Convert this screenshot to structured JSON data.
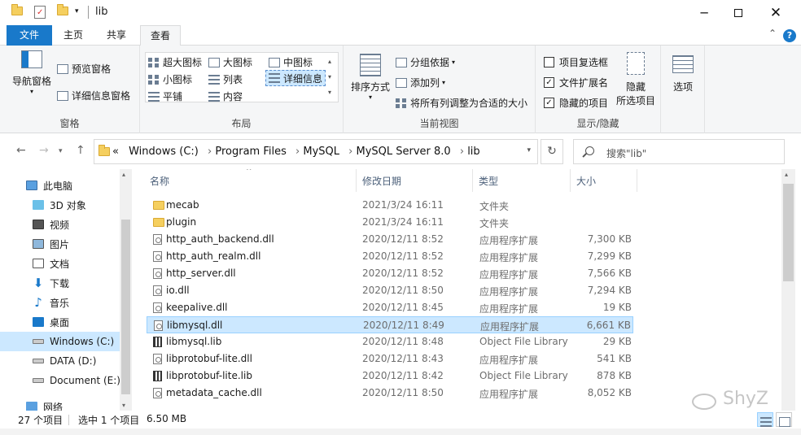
{
  "window": {
    "title": "lib"
  },
  "tabs": [
    "文件",
    "主页",
    "共享",
    "查看"
  ],
  "ribbon": {
    "pane": {
      "nav_pane": "导航窗格",
      "preview": "预览窗格",
      "details": "详细信息窗格",
      "label": "窗格"
    },
    "layout": {
      "xl_icons": "超大图标",
      "l_icons": "大图标",
      "m_icons": "中图标",
      "s_icons": "小图标",
      "list": "列表",
      "details": "详细信息",
      "tiles": "平铺",
      "content": "内容",
      "label": "布局"
    },
    "current_view": {
      "sort": "排序方式",
      "group": "分组依据",
      "add_col": "添加列",
      "fit": "将所有列调整为合适的大小",
      "label": "当前视图"
    },
    "show_hide": {
      "checkboxes": "项目复选框",
      "extensions": "文件扩展名",
      "hidden": "隐藏的项目",
      "checkboxes_checked": false,
      "extensions_checked": true,
      "hidden_checked": true,
      "hide_selected": "隐藏",
      "hide_selected2": "所选项目",
      "label": "显示/隐藏"
    },
    "options": "选项"
  },
  "address": {
    "crumbs": [
      "«",
      "Windows (C:)",
      "Program Files",
      "MySQL",
      "MySQL Server 8.0",
      "lib"
    ],
    "search_placeholder": "搜索\"lib\""
  },
  "nav": [
    {
      "label": "此电脑",
      "icon": "computer-icon"
    },
    {
      "label": "3D 对象",
      "icon": "cube-icon"
    },
    {
      "label": "视频",
      "icon": "video-icon"
    },
    {
      "label": "图片",
      "icon": "picture-icon"
    },
    {
      "label": "文档",
      "icon": "document-icon"
    },
    {
      "label": "下载",
      "icon": "download-icon"
    },
    {
      "label": "音乐",
      "icon": "music-icon"
    },
    {
      "label": "桌面",
      "icon": "desktop-icon"
    },
    {
      "label": "Windows (C:)",
      "icon": "drive-icon"
    },
    {
      "label": "DATA (D:)",
      "icon": "drive-icon"
    },
    {
      "label": "Document (E:)",
      "icon": "drive-icon"
    },
    {
      "label": "网络",
      "icon": "network-icon"
    }
  ],
  "columns": {
    "name": "名称",
    "date": "修改日期",
    "type": "类型",
    "size": "大小"
  },
  "files": [
    {
      "name": "mecab",
      "date": "2021/3/24 16:11",
      "type": "文件夹",
      "size": "",
      "kind": "folder"
    },
    {
      "name": "plugin",
      "date": "2021/3/24 16:11",
      "type": "文件夹",
      "size": "",
      "kind": "folder"
    },
    {
      "name": "http_auth_backend.dll",
      "date": "2020/12/11 8:52",
      "type": "应用程序扩展",
      "size": "7,300 KB",
      "kind": "dll"
    },
    {
      "name": "http_auth_realm.dll",
      "date": "2020/12/11 8:52",
      "type": "应用程序扩展",
      "size": "7,299 KB",
      "kind": "dll"
    },
    {
      "name": "http_server.dll",
      "date": "2020/12/11 8:52",
      "type": "应用程序扩展",
      "size": "7,566 KB",
      "kind": "dll"
    },
    {
      "name": "io.dll",
      "date": "2020/12/11 8:50",
      "type": "应用程序扩展",
      "size": "7,294 KB",
      "kind": "dll"
    },
    {
      "name": "keepalive.dll",
      "date": "2020/12/11 8:45",
      "type": "应用程序扩展",
      "size": "19 KB",
      "kind": "dll"
    },
    {
      "name": "libmysql.dll",
      "date": "2020/12/11 8:49",
      "type": "应用程序扩展",
      "size": "6,661 KB",
      "kind": "dll",
      "selected": true
    },
    {
      "name": "libmysql.lib",
      "date": "2020/12/11 8:48",
      "type": "Object File Library",
      "size": "29 KB",
      "kind": "lib"
    },
    {
      "name": "libprotobuf-lite.dll",
      "date": "2020/12/11 8:43",
      "type": "应用程序扩展",
      "size": "541 KB",
      "kind": "dll"
    },
    {
      "name": "libprotobuf-lite.lib",
      "date": "2020/12/11 8:42",
      "type": "Object File Library",
      "size": "878 KB",
      "kind": "lib"
    },
    {
      "name": "metadata_cache.dll",
      "date": "2020/12/11 8:50",
      "type": "应用程序扩展",
      "size": "8,052 KB",
      "kind": "dll"
    }
  ],
  "status": {
    "count": "27 个项目",
    "selection": "选中 1 个项目",
    "size": "6.50 MB"
  },
  "watermark": "ShyZ"
}
